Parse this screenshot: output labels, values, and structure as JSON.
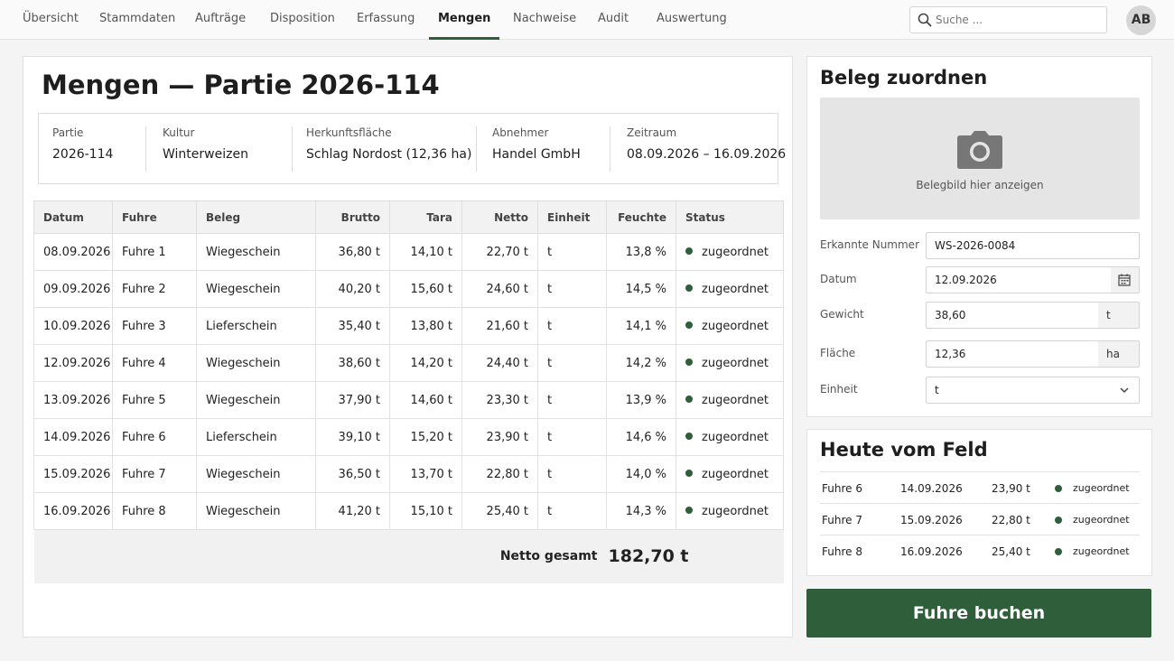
{
  "nav": {
    "items": [
      "Übersicht",
      "Stammdaten",
      "Aufträge",
      "Disposition",
      "Erfassung",
      "Mengen",
      "Nachweise",
      "Audit",
      "Auswertung"
    ],
    "active": "Mengen",
    "search_placeholder": "Suche ...",
    "avatar_initials": "AB"
  },
  "page": {
    "title": "Mengen — Partie 2026-114",
    "info": [
      {
        "label": "Partie",
        "value": "2026-114"
      },
      {
        "label": "Kultur",
        "value": "Winterweizen"
      },
      {
        "label": "Herkunftsfläche",
        "value": "Schlag Nordost (12,36 ha)"
      },
      {
        "label": "Abnehmer",
        "value": "Handel GmbH"
      },
      {
        "label": "Zeitraum",
        "value": "08.09.2026 – 16.09.2026"
      }
    ]
  },
  "table": {
    "headers": [
      "Datum",
      "Fuhre",
      "Beleg",
      "Brutto",
      "Tara",
      "Netto",
      "Einheit",
      "Feuchte",
      "Status"
    ],
    "rows": [
      [
        "08.09.2026",
        "Fuhre 1",
        "Wiegeschein",
        "36,80 t",
        "14,10 t",
        "22,70 t",
        "t",
        "13,8 %",
        "zugeordnet"
      ],
      [
        "09.09.2026",
        "Fuhre 2",
        "Wiegeschein",
        "40,20 t",
        "15,60 t",
        "24,60 t",
        "t",
        "14,5 %",
        "zugeordnet"
      ],
      [
        "10.09.2026",
        "Fuhre 3",
        "Lieferschein",
        "35,40 t",
        "13,80 t",
        "21,60 t",
        "t",
        "14,1 %",
        "zugeordnet"
      ],
      [
        "12.09.2026",
        "Fuhre 4",
        "Wiegeschein",
        "38,60 t",
        "14,20 t",
        "24,40 t",
        "t",
        "14,2 %",
        "zugeordnet"
      ],
      [
        "13.09.2026",
        "Fuhre 5",
        "Wiegeschein",
        "37,90 t",
        "14,60 t",
        "23,30 t",
        "t",
        "13,9 %",
        "zugeordnet"
      ],
      [
        "14.09.2026",
        "Fuhre 6",
        "Lieferschein",
        "39,10 t",
        "15,20 t",
        "23,90 t",
        "t",
        "14,6 %",
        "zugeordnet"
      ],
      [
        "15.09.2026",
        "Fuhre 7",
        "Wiegeschein",
        "36,50 t",
        "13,70 t",
        "22,80 t",
        "t",
        "14,0 %",
        "zugeordnet"
      ],
      [
        "16.09.2026",
        "Fuhre 8",
        "Wiegeschein",
        "41,20 t",
        "15,10 t",
        "25,40 t",
        "t",
        "14,3 %",
        "zugeordnet"
      ]
    ],
    "total_label": "Netto gesamt",
    "total_value": "182,70 t"
  },
  "assign": {
    "title": "Beleg zuordnen",
    "image_caption": "Belegbild hier anzeigen",
    "fields": {
      "number": {
        "label": "Erkannte Nummer",
        "value": "WS-2026-0084"
      },
      "date": {
        "label": "Datum",
        "value": "12.09.2026"
      },
      "weight": {
        "label": "Gewicht",
        "value": "38,60",
        "suffix": "t"
      },
      "area": {
        "label": "Fläche",
        "value": "12,36",
        "suffix": "ha"
      },
      "unit": {
        "label": "Einheit",
        "value": "t"
      }
    }
  },
  "feed": {
    "title": "Heute vom Feld",
    "rows": [
      {
        "fuhre": "Fuhre 6",
        "date": "14.09.2026",
        "netto": "23,90 t",
        "status": "zugeordnet"
      },
      {
        "fuhre": "Fuhre 7",
        "date": "15.09.2026",
        "netto": "22,80 t",
        "status": "zugeordnet"
      },
      {
        "fuhre": "Fuhre 8",
        "date": "16.09.2026",
        "netto": "25,40 t",
        "status": "zugeordnet"
      }
    ]
  },
  "book_button": "Fuhre buchen",
  "colors": {
    "accent": "#2f5e3b",
    "status_ok": "#2f5e3b"
  }
}
